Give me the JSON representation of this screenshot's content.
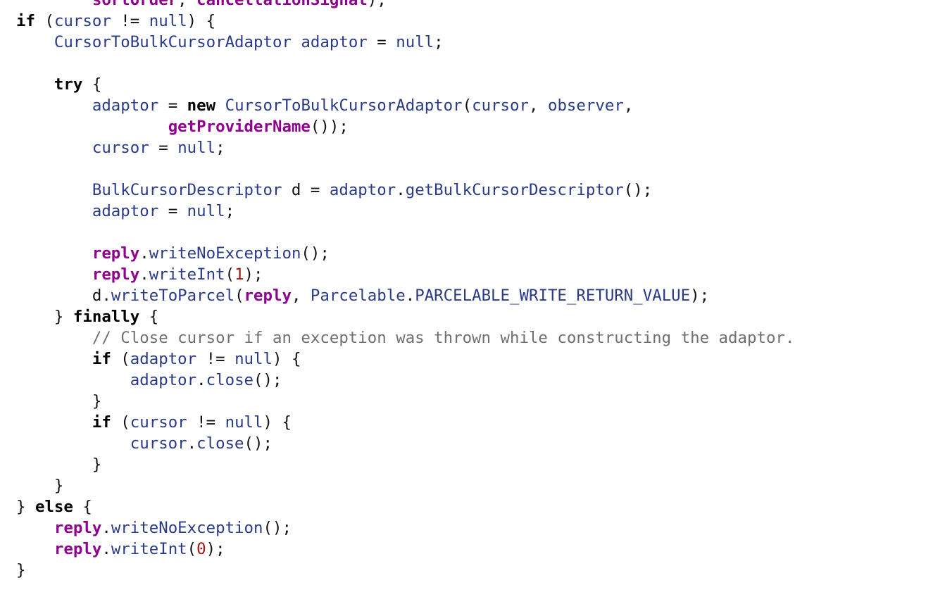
{
  "palette": {
    "keyword": "#000000",
    "identifier": "#2a3a8a",
    "member": "#900090",
    "number": "#a21515",
    "comment": "#707070",
    "plain": "#111111",
    "background": "#ffffff"
  },
  "code": {
    "lines": [
      [
        {
          "t": "        ",
          "c": "plain"
        },
        {
          "t": "sortOrder",
          "c": "member"
        },
        {
          "t": ", ",
          "c": "plain"
        },
        {
          "t": "cancellationSignal",
          "c": "member"
        },
        {
          "t": ");",
          "c": "plain"
        }
      ],
      [
        {
          "t": "if",
          "c": "kw"
        },
        {
          "t": " (",
          "c": "plain"
        },
        {
          "t": "cursor",
          "c": "ident"
        },
        {
          "t": " != ",
          "c": "plain"
        },
        {
          "t": "null",
          "c": "ident"
        },
        {
          "t": ") {",
          "c": "plain"
        }
      ],
      [
        {
          "t": "    ",
          "c": "plain"
        },
        {
          "t": "CursorToBulkCursorAdaptor",
          "c": "ident"
        },
        {
          "t": " ",
          "c": "plain"
        },
        {
          "t": "adaptor",
          "c": "ident"
        },
        {
          "t": " = ",
          "c": "plain"
        },
        {
          "t": "null",
          "c": "ident"
        },
        {
          "t": ";",
          "c": "plain"
        }
      ],
      [],
      [
        {
          "t": "    ",
          "c": "plain"
        },
        {
          "t": "try",
          "c": "kw"
        },
        {
          "t": " {",
          "c": "plain"
        }
      ],
      [
        {
          "t": "        ",
          "c": "plain"
        },
        {
          "t": "adaptor",
          "c": "ident"
        },
        {
          "t": " = ",
          "c": "plain"
        },
        {
          "t": "new",
          "c": "kw"
        },
        {
          "t": " ",
          "c": "plain"
        },
        {
          "t": "CursorToBulkCursorAdaptor",
          "c": "ident"
        },
        {
          "t": "(",
          "c": "plain"
        },
        {
          "t": "cursor",
          "c": "ident"
        },
        {
          "t": ", ",
          "c": "plain"
        },
        {
          "t": "observer",
          "c": "ident"
        },
        {
          "t": ",",
          "c": "plain"
        }
      ],
      [
        {
          "t": "                ",
          "c": "plain"
        },
        {
          "t": "getProviderName",
          "c": "member"
        },
        {
          "t": "());",
          "c": "plain"
        }
      ],
      [
        {
          "t": "        ",
          "c": "plain"
        },
        {
          "t": "cursor",
          "c": "ident"
        },
        {
          "t": " = ",
          "c": "plain"
        },
        {
          "t": "null",
          "c": "ident"
        },
        {
          "t": ";",
          "c": "plain"
        }
      ],
      [],
      [
        {
          "t": "        ",
          "c": "plain"
        },
        {
          "t": "BulkCursorDescriptor",
          "c": "ident"
        },
        {
          "t": " d = ",
          "c": "plain"
        },
        {
          "t": "adaptor",
          "c": "ident"
        },
        {
          "t": ".",
          "c": "plain"
        },
        {
          "t": "getBulkCursorDescriptor",
          "c": "ident"
        },
        {
          "t": "();",
          "c": "plain"
        }
      ],
      [
        {
          "t": "        ",
          "c": "plain"
        },
        {
          "t": "adaptor",
          "c": "ident"
        },
        {
          "t": " = ",
          "c": "plain"
        },
        {
          "t": "null",
          "c": "ident"
        },
        {
          "t": ";",
          "c": "plain"
        }
      ],
      [],
      [
        {
          "t": "        ",
          "c": "plain"
        },
        {
          "t": "reply",
          "c": "member"
        },
        {
          "t": ".",
          "c": "plain"
        },
        {
          "t": "writeNoException",
          "c": "ident"
        },
        {
          "t": "();",
          "c": "plain"
        }
      ],
      [
        {
          "t": "        ",
          "c": "plain"
        },
        {
          "t": "reply",
          "c": "member"
        },
        {
          "t": ".",
          "c": "plain"
        },
        {
          "t": "writeInt",
          "c": "ident"
        },
        {
          "t": "(",
          "c": "plain"
        },
        {
          "t": "1",
          "c": "num"
        },
        {
          "t": ");",
          "c": "plain"
        }
      ],
      [
        {
          "t": "        d.",
          "c": "plain"
        },
        {
          "t": "writeToParcel",
          "c": "ident"
        },
        {
          "t": "(",
          "c": "plain"
        },
        {
          "t": "reply",
          "c": "member"
        },
        {
          "t": ", ",
          "c": "plain"
        },
        {
          "t": "Parcelable",
          "c": "ident"
        },
        {
          "t": ".",
          "c": "plain"
        },
        {
          "t": "PARCELABLE_WRITE_RETURN_VALUE",
          "c": "ident"
        },
        {
          "t": ");",
          "c": "plain"
        }
      ],
      [
        {
          "t": "    } ",
          "c": "plain"
        },
        {
          "t": "finally",
          "c": "kw"
        },
        {
          "t": " {",
          "c": "plain"
        }
      ],
      [
        {
          "t": "        ",
          "c": "plain"
        },
        {
          "t": "// Close cursor if an exception was thrown while constructing the adaptor.",
          "c": "comment"
        }
      ],
      [
        {
          "t": "        ",
          "c": "plain"
        },
        {
          "t": "if",
          "c": "kw"
        },
        {
          "t": " (",
          "c": "plain"
        },
        {
          "t": "adaptor",
          "c": "ident"
        },
        {
          "t": " != ",
          "c": "plain"
        },
        {
          "t": "null",
          "c": "ident"
        },
        {
          "t": ") {",
          "c": "plain"
        }
      ],
      [
        {
          "t": "            ",
          "c": "plain"
        },
        {
          "t": "adaptor",
          "c": "ident"
        },
        {
          "t": ".",
          "c": "plain"
        },
        {
          "t": "close",
          "c": "ident"
        },
        {
          "t": "();",
          "c": "plain"
        }
      ],
      [
        {
          "t": "        }",
          "c": "plain"
        }
      ],
      [
        {
          "t": "        ",
          "c": "plain"
        },
        {
          "t": "if",
          "c": "kw"
        },
        {
          "t": " (",
          "c": "plain"
        },
        {
          "t": "cursor",
          "c": "ident"
        },
        {
          "t": " != ",
          "c": "plain"
        },
        {
          "t": "null",
          "c": "ident"
        },
        {
          "t": ") {",
          "c": "plain"
        }
      ],
      [
        {
          "t": "            ",
          "c": "plain"
        },
        {
          "t": "cursor",
          "c": "ident"
        },
        {
          "t": ".",
          "c": "plain"
        },
        {
          "t": "close",
          "c": "ident"
        },
        {
          "t": "();",
          "c": "plain"
        }
      ],
      [
        {
          "t": "        }",
          "c": "plain"
        }
      ],
      [
        {
          "t": "    }",
          "c": "plain"
        }
      ],
      [
        {
          "t": "} ",
          "c": "plain"
        },
        {
          "t": "else",
          "c": "kw"
        },
        {
          "t": " {",
          "c": "plain"
        }
      ],
      [
        {
          "t": "    ",
          "c": "plain"
        },
        {
          "t": "reply",
          "c": "member"
        },
        {
          "t": ".",
          "c": "plain"
        },
        {
          "t": "writeNoException",
          "c": "ident"
        },
        {
          "t": "();",
          "c": "plain"
        }
      ],
      [
        {
          "t": "    ",
          "c": "plain"
        },
        {
          "t": "reply",
          "c": "member"
        },
        {
          "t": ".",
          "c": "plain"
        },
        {
          "t": "writeInt",
          "c": "ident"
        },
        {
          "t": "(",
          "c": "plain"
        },
        {
          "t": "0",
          "c": "num"
        },
        {
          "t": ");",
          "c": "plain"
        }
      ],
      [
        {
          "t": "}",
          "c": "plain"
        }
      ]
    ]
  }
}
